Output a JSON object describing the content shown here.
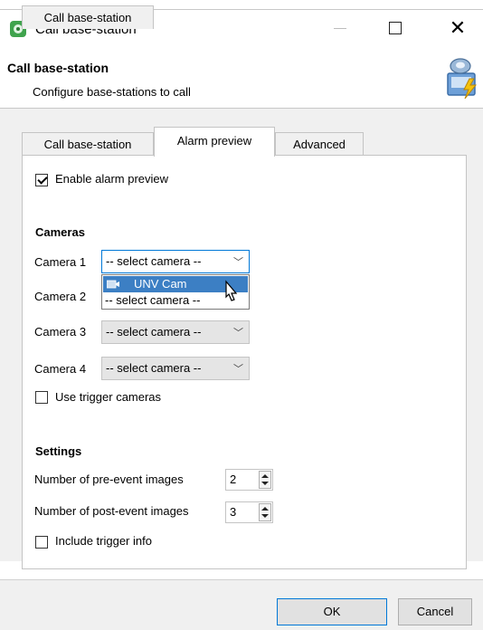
{
  "window": {
    "title": "Call base-station",
    "minimize_glyph": "—",
    "close_glyph": "✕"
  },
  "header": {
    "title": "Call base-station",
    "subtitle": "Configure base-stations to call"
  },
  "tabs": [
    {
      "label": "Call base-station",
      "active": false
    },
    {
      "label": "Alarm preview",
      "active": true
    },
    {
      "label": "Advanced",
      "active": false
    }
  ],
  "alarm_preview": {
    "enable_label": "Enable alarm preview",
    "enable_checked": true,
    "cameras_heading": "Cameras",
    "cameras": [
      {
        "label": "Camera 1",
        "value": "-- select camera --"
      },
      {
        "label": "Camera 2",
        "value": "-- select camera --"
      },
      {
        "label": "Camera 3",
        "value": "-- select camera --"
      },
      {
        "label": "Camera 4",
        "value": "-- select camera --"
      }
    ],
    "dropdown_options": [
      "UNV Cam",
      "-- select camera --"
    ],
    "dropdown_highlighted": "UNV Cam",
    "use_trigger_label": "Use trigger cameras",
    "use_trigger_checked": false,
    "settings_heading": "Settings",
    "pre_event_label": "Number of pre-event images",
    "pre_event_value": "2",
    "post_event_label": "Number of post-event images",
    "post_event_value": "3",
    "include_trigger_label": "Include trigger info",
    "include_trigger_checked": false
  },
  "footer": {
    "ok_label": "OK",
    "cancel_label": "Cancel"
  },
  "colors": {
    "accent": "#0078d7",
    "selection": "#3c7fc4",
    "app_icon": "#3fa34d"
  },
  "icons": {
    "app": "app-eye-icon",
    "header": "base-station-lightning-icon",
    "camera": "camera-icon",
    "cursor": "mouse-cursor-icon"
  }
}
